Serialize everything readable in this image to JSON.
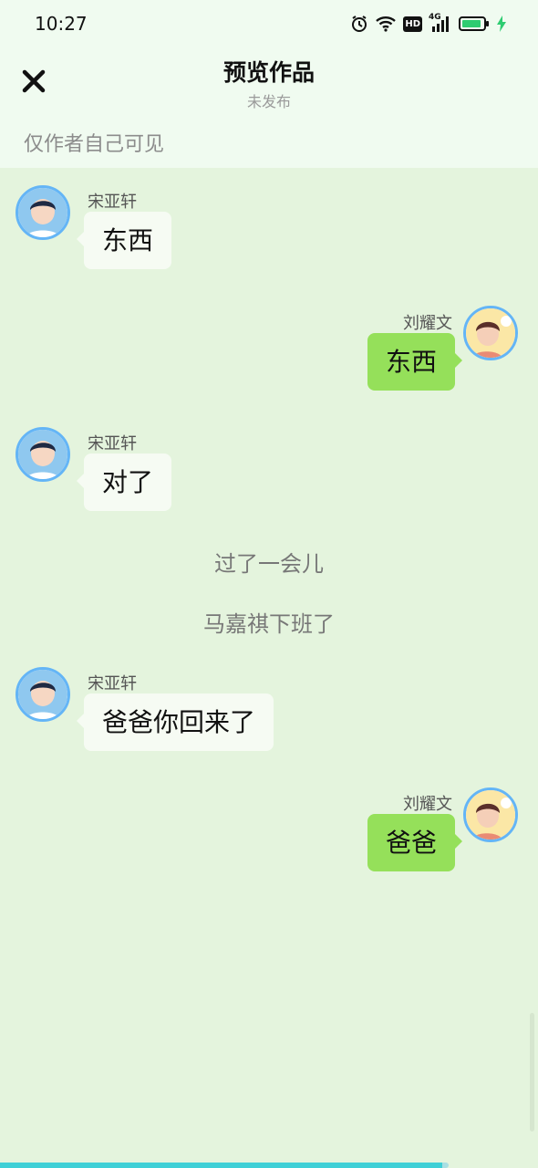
{
  "status_bar": {
    "time": "10:27",
    "icons": [
      "alarm-icon",
      "wifi-icon",
      "hd-icon",
      "signal-4g-icon",
      "battery-icon",
      "charging-icon"
    ],
    "hd_label": "HD",
    "network_label": "4G"
  },
  "header": {
    "title": "预览作品",
    "subtitle": "未发布",
    "visibility_note": "仅作者自己可见",
    "close_icon": "close-icon"
  },
  "colors": {
    "chat_background": "#e4f4dd",
    "header_background": "#f0fbf0",
    "left_bubble": "#f6fbf3",
    "right_bubble": "#95e05a",
    "avatar_ring": "#64b5f6"
  },
  "messages": [
    {
      "side": "left",
      "name": "宋亚轩",
      "text": "东西"
    },
    {
      "side": "right",
      "name": "刘耀文",
      "text": "东西"
    },
    {
      "side": "left",
      "name": "宋亚轩",
      "text": "对了"
    },
    {
      "side": "narration",
      "text": "过了一会儿"
    },
    {
      "side": "narration",
      "text": "马嘉祺下班了"
    },
    {
      "side": "left",
      "name": "宋亚轩",
      "text": "爸爸你回来了"
    },
    {
      "side": "right",
      "name": "刘耀文",
      "text": "爸爸"
    }
  ]
}
